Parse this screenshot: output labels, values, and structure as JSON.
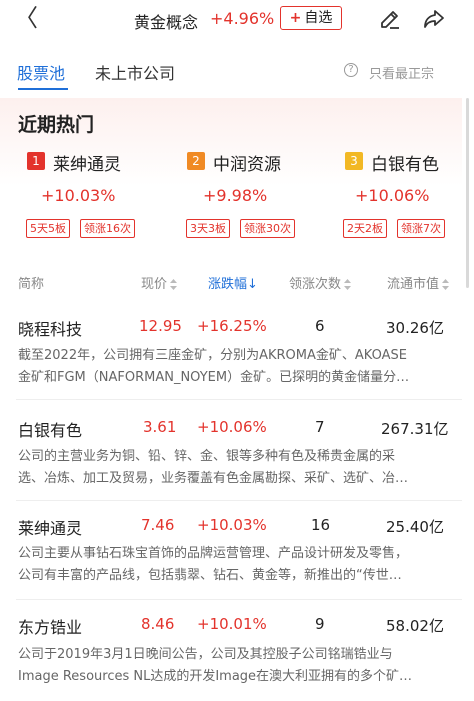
{
  "header": {
    "back": "〈",
    "title": "黄金概念",
    "change": "+4.96%",
    "add_label": "自选",
    "add_plus": "+"
  },
  "tabs": [
    {
      "label": "股票池"
    },
    {
      "label": "未上市公司"
    }
  ],
  "listed_only": "只看最正宗",
  "hot": {
    "title": "近期热门",
    "items": [
      {
        "rank": "1",
        "name": "莱绅通灵",
        "change": "+10.03%",
        "tag1": "5天5板",
        "tag2": "领涨16次",
        "color": "#e3332c"
      },
      {
        "rank": "2",
        "name": "中润资源",
        "change": "+9.98%",
        "tag1": "3天3板",
        "tag2": "领涨30次",
        "color": "#f08a24"
      },
      {
        "rank": "3",
        "name": "白银有色",
        "change": "+10.06%",
        "tag1": "2天2板",
        "tag2": "领涨7次",
        "color": "#f2b824"
      }
    ]
  },
  "columns": {
    "name": "简称",
    "price": "现价",
    "change": "涨跌幅↓",
    "times": "领涨次数",
    "cap": "流通市值"
  },
  "rows": [
    {
      "name": "晓程科技",
      "price": "12.95",
      "change": "+16.25%",
      "times": "6",
      "cap": "30.26亿",
      "desc1": "截至2022年，公司拥有三座金矿，分别为AKROMA金矿、AKOASE",
      "desc2": "金矿和FGM（NAFORMAN_NOYEM）金矿。已探明的黄金储量分…"
    },
    {
      "name": "白银有色",
      "price": "3.61",
      "change": "+10.06%",
      "times": "7",
      "cap": "267.31亿",
      "desc1": "公司的主营业务为铜、铅、锌、金、银等多种有色及稀贵金属的采",
      "desc2": "选、冶炼、加工及贸易，业务覆盖有色金属勘探、采矿、选矿、冶…"
    },
    {
      "name": "莱绅通灵",
      "price": "7.46",
      "change": "+10.03%",
      "times": "16",
      "cap": "25.40亿",
      "desc1": "公司主要从事钻石珠宝首饰的品牌运营管理、产品设计研发及零售，",
      "desc2": "公司有丰富的产品线，包括翡翠、钻石、黄金等，新推出的“传世…"
    },
    {
      "name": "东方锆业",
      "price": "8.46",
      "change": "+10.01%",
      "times": "9",
      "cap": "58.02亿",
      "desc1": "公司于2019年3月1日晚间公告，公司及其控股子公司铭瑞锆业与",
      "desc2": "Image Resources NL达成的开发Image在澳大利亚拥有的多个矿…"
    }
  ]
}
